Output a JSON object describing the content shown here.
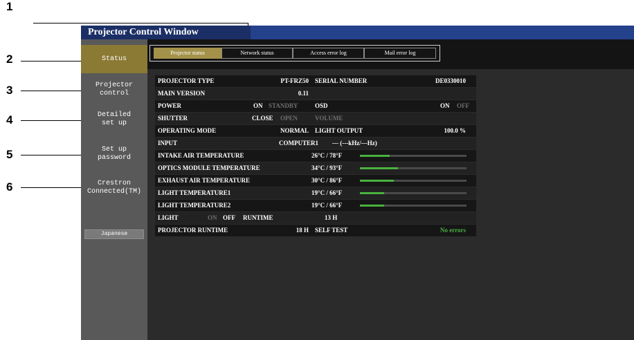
{
  "callouts": [
    "1",
    "2",
    "3",
    "4",
    "5",
    "6"
  ],
  "window": {
    "title": "Projector Control Window"
  },
  "sidebar": {
    "items": [
      {
        "label": "Status"
      },
      {
        "label": "Projector\ncontrol"
      },
      {
        "label": "Detailed\nset up"
      },
      {
        "label": "Set up\npassword"
      },
      {
        "label": "Crestron\nConnected(TM)"
      }
    ],
    "language_button": "Japanese"
  },
  "tabs": [
    "Projector status",
    "Network status",
    "Access error log",
    "Mail error log"
  ],
  "status": {
    "projector_type_label": "PROJECTOR TYPE",
    "projector_type_value": "PT-FRZ50",
    "serial_number_label": "SERIAL NUMBER",
    "serial_number_value": "DE0330010",
    "main_version_label": "MAIN VERSION",
    "main_version_value": "0.11",
    "power_label": "POWER",
    "power_on": "ON",
    "power_standby": "STANDBY",
    "osd_label": "OSD",
    "osd_on": "ON",
    "osd_off": "OFF",
    "shutter_label": "SHUTTER",
    "shutter_close": "CLOSE",
    "shutter_open": "OPEN",
    "volume_label": "VOLUME",
    "operating_mode_label": "OPERATING MODE",
    "operating_mode_value": "NORMAL",
    "light_output_label": "LIGHT OUTPUT",
    "light_output_value": "100.0 %",
    "input_label": "INPUT",
    "input_value": "COMPUTER1",
    "input_signal": "--- (---kHz/---Hz)",
    "temperatures": [
      {
        "label": "INTAKE AIR TEMPERATURE",
        "value": "26°C / 78°F",
        "level": 0.28
      },
      {
        "label": "OPTICS MODULE TEMPERATURE",
        "value": "34°C / 93°F",
        "level": 0.36
      },
      {
        "label": "EXHAUST AIR TEMPERATURE",
        "value": "30°C / 86°F",
        "level": 0.32
      },
      {
        "label": "LIGHT TEMPERATURE1",
        "value": "19°C / 66°F",
        "level": 0.23
      },
      {
        "label": "LIGHT TEMPERATURE2",
        "value": "19°C / 66°F",
        "level": 0.23
      }
    ],
    "light_label": "LIGHT",
    "light_on": "ON",
    "light_off": "OFF",
    "runtime_label": "RUNTIME",
    "runtime_value": "13 H",
    "projector_runtime_label": "PROJECTOR RUNTIME",
    "projector_runtime_value": "18 H",
    "self_test_label": "SELF TEST",
    "self_test_value": "No errors"
  }
}
